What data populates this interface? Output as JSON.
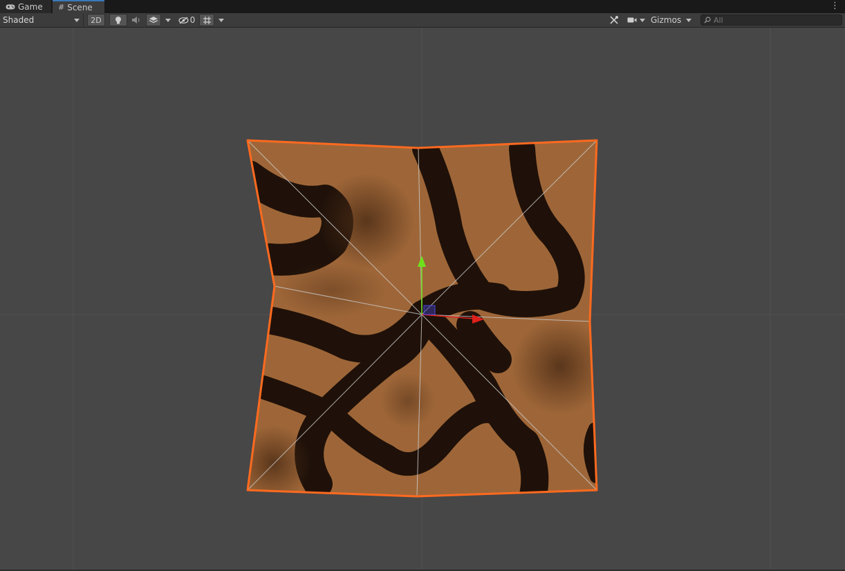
{
  "tabs": [
    {
      "label": "Game",
      "icon": "gamepad-icon",
      "active": false
    },
    {
      "label": "Scene",
      "icon": "hash-icon",
      "active": true
    }
  ],
  "toolbar": {
    "shading_mode": "Shaded",
    "toggle_2d": "2D",
    "hidden_count": "0",
    "gizmos_label": "Gizmos",
    "search_placeholder": "All"
  },
  "colors": {
    "selection_outline": "#ff6a1f",
    "axis_x": "#e0201c",
    "axis_y": "#6ee21c",
    "tab_accent": "#3a79bb"
  }
}
